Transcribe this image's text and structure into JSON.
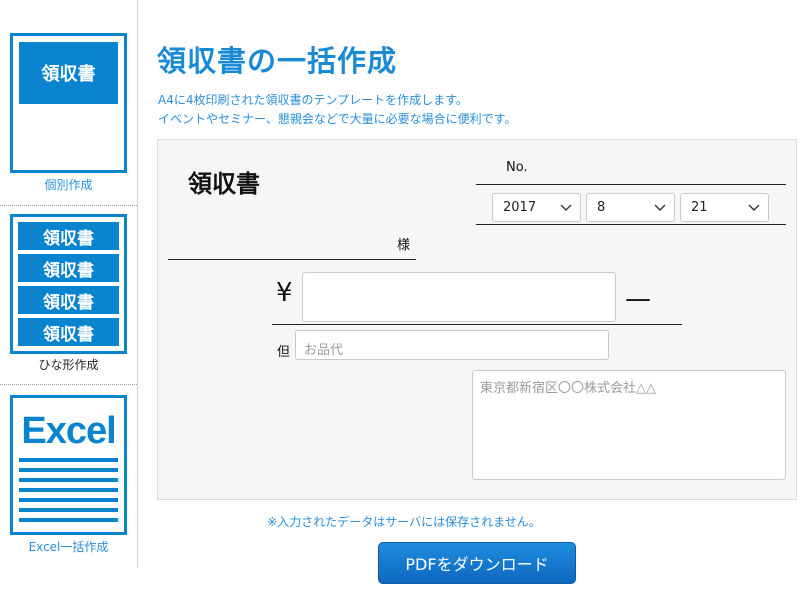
{
  "sidebar": {
    "items": [
      {
        "label": "個別作成",
        "thumb_text": "領収書"
      },
      {
        "label": "ひな形作成",
        "thumb_texts": [
          "領収書",
          "領収書",
          "領収書",
          "領収書"
        ]
      },
      {
        "label": "Excel一括作成",
        "thumb_text": "Excel"
      }
    ]
  },
  "page": {
    "title": "領収書の一括作成",
    "description": [
      "A4に4枚印刷された領収書のテンプレートを作成します。",
      "イベントやセミナー、懇親会などで大量に必要な場合に便利です。"
    ]
  },
  "receipt": {
    "title": "領収書",
    "no_label": "No.",
    "date": {
      "year": "2017",
      "month": "8",
      "day": "21"
    },
    "recipient_suffix": "様",
    "currency_symbol": "¥",
    "amount_value": "",
    "amount_suffix": "—",
    "proviso_label": "但",
    "proviso_placeholder": "お品代",
    "issuer_placeholder": "東京都新宿区〇〇株式会社△△"
  },
  "notice": "※入力されたデータはサーバには保存されません。",
  "download_button": "PDFをダウンロード",
  "colors": {
    "accent": "#0a84cf",
    "title": "#1a8ad4",
    "text_blue": "#2a8fd6"
  }
}
